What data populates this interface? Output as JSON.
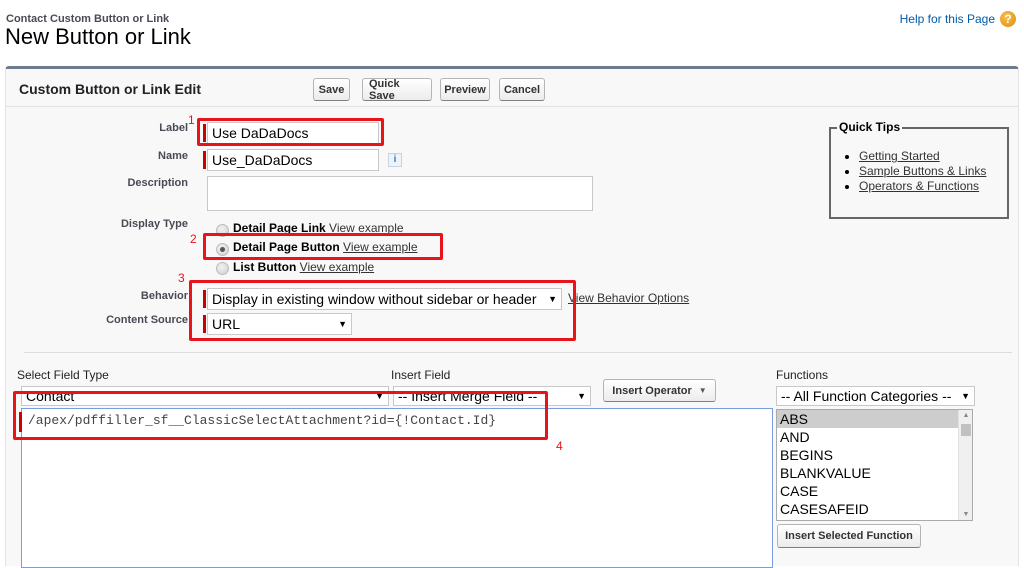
{
  "header": {
    "subtitle": "Contact Custom Button or Link",
    "title": "New Button or Link",
    "help_link": "Help for this Page",
    "help_icon": "question-circle-icon"
  },
  "panel": {
    "title": "Custom Button or Link Edit",
    "buttons": {
      "save": "Save",
      "quick_save": "Quick Save",
      "preview": "Preview",
      "cancel": "Cancel"
    }
  },
  "form": {
    "label": {
      "label": "Label",
      "value": "Use DaDaDocs"
    },
    "name": {
      "label": "Name",
      "value": "Use_DaDaDocs",
      "info_icon": "i"
    },
    "description": {
      "label": "Description",
      "value": ""
    },
    "display_type": {
      "label": "Display Type",
      "options": [
        {
          "label": "Detail Page Link",
          "link": "View example",
          "selected": false
        },
        {
          "label": "Detail Page Button",
          "link": "View example",
          "selected": true
        },
        {
          "label": "List Button",
          "link": "View example",
          "selected": false
        }
      ]
    },
    "behavior": {
      "label": "Behavior",
      "value": "Display in existing window without sidebar or header",
      "options_link": "View Behavior Options"
    },
    "content_source": {
      "label": "Content Source",
      "value": "URL"
    }
  },
  "annotations": [
    "1",
    "2",
    "3",
    "4"
  ],
  "quick_tips": {
    "title": "Quick Tips",
    "links": [
      "Getting Started",
      "Sample Buttons & Links",
      "Operators & Functions"
    ]
  },
  "editor": {
    "select_field_type": {
      "label": "Select Field Type",
      "value": "Contact"
    },
    "insert_field": {
      "label": "Insert Field",
      "value": "-- Insert Merge Field --"
    },
    "insert_operator": "Insert Operator",
    "code": "/apex/pdffiller_sf__ClassicSelectAttachment?id={!Contact.Id}"
  },
  "functions": {
    "label": "Functions",
    "category": "-- All Function Categories --",
    "items": [
      "ABS",
      "AND",
      "BEGINS",
      "BLANKVALUE",
      "CASE",
      "CASESAFEID"
    ],
    "selected": "ABS",
    "insert_button": "Insert Selected Function"
  },
  "colors": {
    "annotation_red": "#e8141a",
    "required_bar": "#cc0000",
    "link_blue": "#015ba7",
    "panel_border": "#6f7a8e"
  }
}
